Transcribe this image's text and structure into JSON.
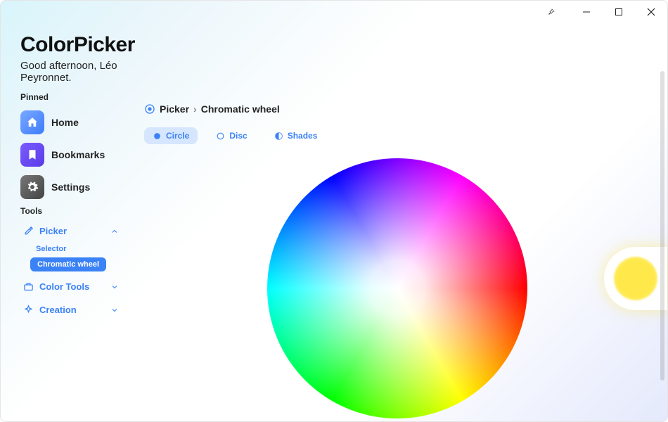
{
  "app": {
    "title": "ColorPicker",
    "greeting": "Good afternoon, Léo Peyronnet."
  },
  "sidebar": {
    "pinned_label": "Pinned",
    "tools_label": "Tools",
    "pinned": [
      {
        "id": "home",
        "label": "Home"
      },
      {
        "id": "bookmarks",
        "label": "Bookmarks"
      },
      {
        "id": "settings",
        "label": "Settings"
      }
    ],
    "tools": {
      "picker": {
        "label": "Picker",
        "expanded": true,
        "items": [
          {
            "label": "Selector",
            "active": false
          },
          {
            "label": "Chromatic wheel",
            "active": true
          }
        ]
      },
      "color_tools": {
        "label": "Color Tools"
      },
      "creation": {
        "label": "Creation"
      }
    }
  },
  "breadcrumb": {
    "root": "Picker",
    "sep": "›",
    "current": "Chromatic wheel"
  },
  "tabs": {
    "circle": "Circle",
    "disc": "Disc",
    "shades": "Shades"
  },
  "swatch_color": "#ffe94a"
}
